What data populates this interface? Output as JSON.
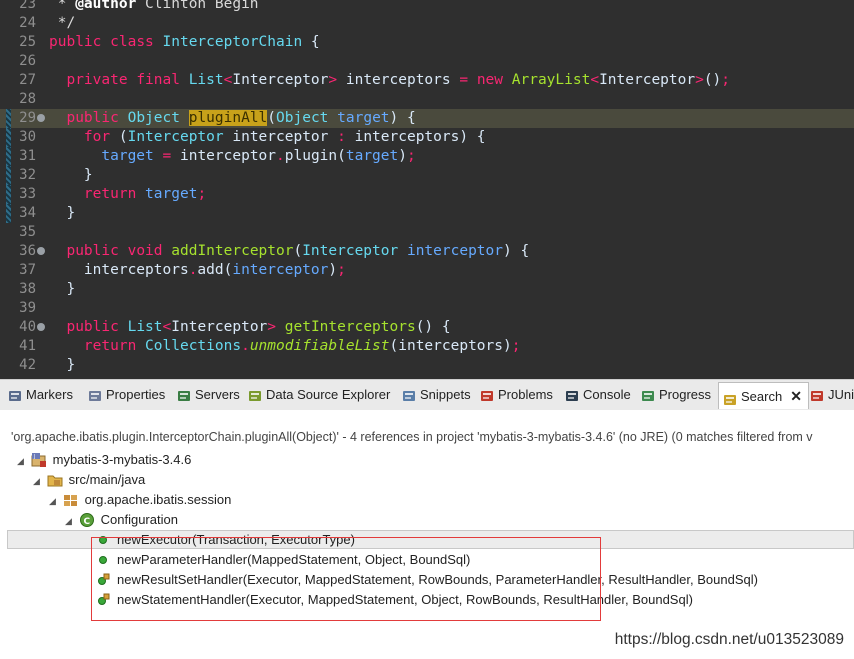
{
  "editor": {
    "lines": [
      {
        "num": "23",
        "marker": false,
        "fold": false,
        "hl": false,
        "tokens": [
          [
            "cm",
            " * "
          ],
          [
            "ann",
            "@author"
          ],
          [
            "cm",
            " Clinton Begin"
          ]
        ]
      },
      {
        "num": "24",
        "marker": false,
        "fold": false,
        "hl": false,
        "tokens": [
          [
            "cm",
            " */"
          ]
        ]
      },
      {
        "num": "25",
        "marker": false,
        "fold": false,
        "hl": false,
        "tokens": [
          [
            "kw2",
            "public"
          ],
          [
            "id",
            " "
          ],
          [
            "kw2",
            "class"
          ],
          [
            "id",
            " "
          ],
          [
            "ty",
            "InterceptorChain"
          ],
          [
            "id",
            " {"
          ]
        ]
      },
      {
        "num": "26",
        "marker": false,
        "fold": false,
        "hl": false,
        "tokens": []
      },
      {
        "num": "27",
        "marker": false,
        "fold": false,
        "hl": false,
        "tokens": [
          [
            "id",
            "  "
          ],
          [
            "kw2",
            "private"
          ],
          [
            "id",
            " "
          ],
          [
            "kw2",
            "final"
          ],
          [
            "id",
            " "
          ],
          [
            "ty",
            "List"
          ],
          [
            "op",
            "<"
          ],
          [
            "id",
            "Interceptor"
          ],
          [
            "op",
            ">"
          ],
          [
            "id",
            " interceptors "
          ],
          [
            "op",
            "="
          ],
          [
            "id",
            " "
          ],
          [
            "kw2",
            "new"
          ],
          [
            "id",
            " "
          ],
          [
            "fn",
            "ArrayList"
          ],
          [
            "op",
            "<"
          ],
          [
            "id",
            "Interceptor"
          ],
          [
            "op",
            ">"
          ],
          [
            "id",
            "()"
          ],
          [
            "op",
            ";"
          ]
        ]
      },
      {
        "num": "28",
        "marker": false,
        "fold": false,
        "hl": false,
        "tokens": []
      },
      {
        "num": "29",
        "marker": true,
        "fold": true,
        "hl": true,
        "tokens": [
          [
            "id",
            "  "
          ],
          [
            "kw2",
            "public"
          ],
          [
            "id",
            " "
          ],
          [
            "ty",
            "Object"
          ],
          [
            "id",
            " "
          ],
          [
            "sel",
            "pluginAll"
          ],
          [
            "id",
            "("
          ],
          [
            "ty",
            "Object"
          ],
          [
            "id",
            " "
          ],
          [
            "param",
            "target"
          ],
          [
            "id",
            ") {"
          ]
        ]
      },
      {
        "num": "30",
        "marker": true,
        "fold": false,
        "hl": false,
        "tokens": [
          [
            "id",
            "    "
          ],
          [
            "kw2",
            "for"
          ],
          [
            "id",
            " ("
          ],
          [
            "ty",
            "Interceptor"
          ],
          [
            "id",
            " interceptor "
          ],
          [
            "op",
            ":"
          ],
          [
            "id",
            " interceptors) {"
          ]
        ]
      },
      {
        "num": "31",
        "marker": true,
        "fold": false,
        "hl": false,
        "tokens": [
          [
            "id",
            "      "
          ],
          [
            "param",
            "target"
          ],
          [
            "id",
            " "
          ],
          [
            "op",
            "="
          ],
          [
            "id",
            " interceptor"
          ],
          [
            "op",
            "."
          ],
          [
            "id",
            "plugin("
          ],
          [
            "param",
            "target"
          ],
          [
            "id",
            ")"
          ],
          [
            "op",
            ";"
          ]
        ]
      },
      {
        "num": "32",
        "marker": true,
        "fold": false,
        "hl": false,
        "tokens": [
          [
            "id",
            "    }"
          ]
        ]
      },
      {
        "num": "33",
        "marker": true,
        "fold": false,
        "hl": false,
        "tokens": [
          [
            "id",
            "    "
          ],
          [
            "kw2",
            "return"
          ],
          [
            "id",
            " "
          ],
          [
            "param",
            "target"
          ],
          [
            "op",
            ";"
          ]
        ]
      },
      {
        "num": "34",
        "marker": true,
        "fold": false,
        "hl": false,
        "tokens": [
          [
            "id",
            "  }"
          ]
        ]
      },
      {
        "num": "35",
        "marker": false,
        "fold": false,
        "hl": false,
        "tokens": []
      },
      {
        "num": "36",
        "marker": false,
        "fold": true,
        "hl": false,
        "tokens": [
          [
            "id",
            "  "
          ],
          [
            "kw2",
            "public"
          ],
          [
            "id",
            " "
          ],
          [
            "kw2",
            "void"
          ],
          [
            "id",
            " "
          ],
          [
            "fn",
            "addInterceptor"
          ],
          [
            "id",
            "("
          ],
          [
            "ty",
            "Interceptor"
          ],
          [
            "id",
            " "
          ],
          [
            "param",
            "interceptor"
          ],
          [
            "id",
            ") {"
          ]
        ]
      },
      {
        "num": "37",
        "marker": false,
        "fold": false,
        "hl": false,
        "tokens": [
          [
            "id",
            "    interceptors"
          ],
          [
            "op",
            "."
          ],
          [
            "id",
            "add("
          ],
          [
            "param",
            "interceptor"
          ],
          [
            "id",
            ")"
          ],
          [
            "op",
            ";"
          ]
        ]
      },
      {
        "num": "38",
        "marker": false,
        "fold": false,
        "hl": false,
        "tokens": [
          [
            "id",
            "  }"
          ]
        ]
      },
      {
        "num": "39",
        "marker": false,
        "fold": false,
        "hl": false,
        "tokens": []
      },
      {
        "num": "40",
        "marker": false,
        "fold": true,
        "hl": false,
        "tokens": [
          [
            "id",
            "  "
          ],
          [
            "kw2",
            "public"
          ],
          [
            "id",
            " "
          ],
          [
            "ty",
            "List"
          ],
          [
            "op",
            "<"
          ],
          [
            "id",
            "Interceptor"
          ],
          [
            "op",
            ">"
          ],
          [
            "id",
            " "
          ],
          [
            "fn",
            "getInterceptors"
          ],
          [
            "id",
            "() {"
          ]
        ]
      },
      {
        "num": "41",
        "marker": false,
        "fold": false,
        "hl": false,
        "tokens": [
          [
            "id",
            "    "
          ],
          [
            "kw2",
            "return"
          ],
          [
            "id",
            " "
          ],
          [
            "ty",
            "Collections"
          ],
          [
            "op",
            "."
          ],
          [
            "it",
            "unmodifiableList"
          ],
          [
            "id",
            "(interceptors)"
          ],
          [
            "op",
            ";"
          ]
        ]
      },
      {
        "num": "42",
        "marker": false,
        "fold": false,
        "hl": false,
        "tokens": [
          [
            "id",
            "  }"
          ]
        ]
      }
    ]
  },
  "tabs": [
    {
      "label": "Markers",
      "icon": "markers-icon",
      "color": "#5a6b8c"
    },
    {
      "label": "Properties",
      "icon": "properties-icon",
      "color": "#6d7a99"
    },
    {
      "label": "Servers",
      "icon": "servers-icon",
      "color": "#3a7d44"
    },
    {
      "label": "Data Source Explorer",
      "icon": "data-source-icon",
      "color": "#7a9a2e"
    },
    {
      "label": "Snippets",
      "icon": "snippets-icon",
      "color": "#5a7ea8"
    },
    {
      "label": "Problems",
      "icon": "problems-icon",
      "color": "#c0392b"
    },
    {
      "label": "Console",
      "icon": "console-icon",
      "color": "#2c3e50"
    },
    {
      "label": "Progress",
      "icon": "progress-icon",
      "color": "#3d8a4f"
    },
    {
      "label": "Search",
      "icon": "search-icon",
      "color": "#c9a227",
      "active": true
    },
    {
      "label": "JUni",
      "icon": "junit-icon",
      "color": "#c0392b"
    }
  ],
  "search": {
    "summary": "'org.apache.ibatis.plugin.InterceptorChain.pluginAll(Object)' - 4 references in project 'mybatis-3-mybatis-3.4.6' (no JRE) (0 matches filtered from v",
    "tree": {
      "project": "mybatis-3-mybatis-3.4.6",
      "src": "src/main/java",
      "package": "org.apache.ibatis.session",
      "class": "Configuration",
      "methods": [
        {
          "label": "newExecutor(Transaction, ExecutorType)",
          "kind": "public"
        },
        {
          "label": "newParameterHandler(MappedStatement, Object, BoundSql)",
          "kind": "public"
        },
        {
          "label": "newResultSetHandler(Executor, MappedStatement, RowBounds, ParameterHandler, ResultHandler, BoundSql)",
          "kind": "synchronized"
        },
        {
          "label": "newStatementHandler(Executor, MappedStatement, Object, RowBounds, ResultHandler, BoundSql)",
          "kind": "synchronized"
        }
      ]
    }
  },
  "watermark": "https://blog.csdn.net/u013523089"
}
